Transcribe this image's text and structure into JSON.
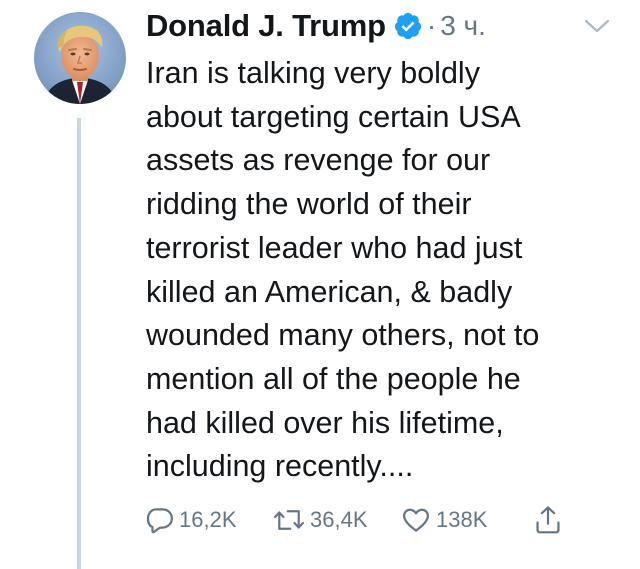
{
  "tweet": {
    "author_name": "Donald J. Trump",
    "verified": true,
    "separator": "·",
    "timestamp": "3 ч.",
    "text": "Iran is talking very boldly\nabout targeting certain USA\nassets as revenge for our\nridding the world of their\nterrorist leader who had just\nkilled an American, & badly\nwounded many others, not to\nmention all of the people he\nhad killed over his lifetime,\nincluding recently....",
    "actions": {
      "replies": "16,2K",
      "retweets": "36,4K",
      "likes": "138K"
    }
  },
  "colors": {
    "text": "#14171a",
    "secondary": "#657786",
    "verified_badge": "#1da1f2",
    "thread_line": "#ccd6dd"
  },
  "icons": {
    "verified": "verified-badge-icon",
    "caret": "chevron-down-icon",
    "reply": "reply-icon",
    "retweet": "retweet-icon",
    "like": "heart-icon",
    "share": "share-icon"
  }
}
